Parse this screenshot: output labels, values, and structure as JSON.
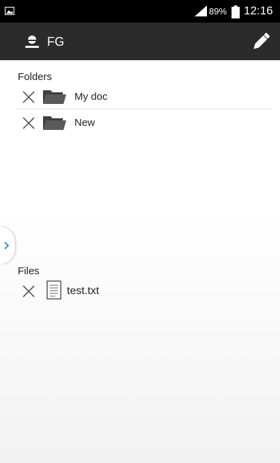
{
  "status_bar": {
    "battery_percent": "89%",
    "time": "12:16"
  },
  "action_bar": {
    "title": "FG",
    "user_icon": "user-icon",
    "edit_icon": "pencil-icon"
  },
  "folders": {
    "header": "Folders",
    "items": [
      {
        "name": "My doc"
      },
      {
        "name": "New"
      }
    ]
  },
  "files": {
    "header": "Files",
    "items": [
      {
        "name": "test.txt"
      }
    ]
  }
}
